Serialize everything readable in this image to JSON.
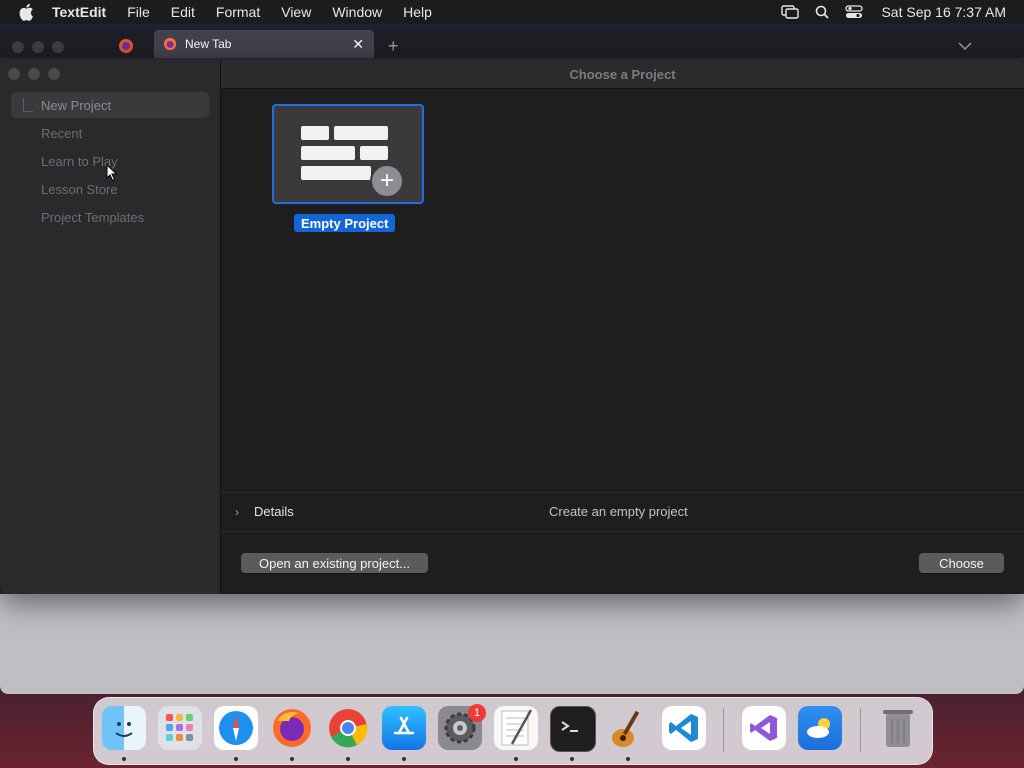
{
  "menubar": {
    "app_name": "TextEdit",
    "menus": [
      "File",
      "Edit",
      "Format",
      "View",
      "Window",
      "Help"
    ],
    "clock": "Sat Sep 16  7:37 AM"
  },
  "browser": {
    "tab_title": "New Tab",
    "close_glyph": "✕",
    "new_tab_glyph": "+"
  },
  "dialog": {
    "title": "Choose a Project",
    "sidebar": {
      "items": [
        "New Project",
        "Recent",
        "Learn to Play",
        "Lesson Store",
        "Project Templates"
      ],
      "selected": "New Project"
    },
    "template": {
      "label": "Empty Project",
      "plus_glyph": "+"
    },
    "details": {
      "label": "Details",
      "description": "Create an empty project",
      "chevron": "›"
    },
    "buttons": {
      "open_existing": "Open an existing project...",
      "choose": "Choose"
    }
  },
  "dock": {
    "apps": [
      "finder",
      "launchpad",
      "safari",
      "firefox",
      "chrome",
      "app-store",
      "system-settings",
      "textedit",
      "terminal",
      "garageband",
      "vscode",
      "visual-studio",
      "weather",
      "trash"
    ],
    "system_settings_badge": "1"
  },
  "colors": {
    "accent": "#1267d8",
    "selection_border": "#1f6fe0"
  }
}
